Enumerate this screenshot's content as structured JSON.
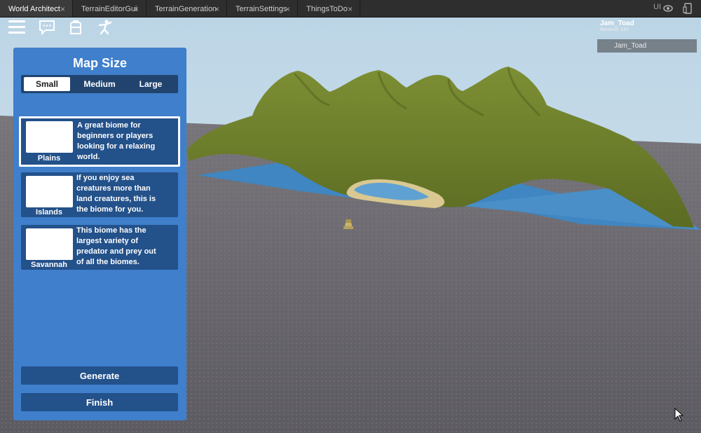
{
  "tabs": [
    {
      "label": "World Architect",
      "active": true
    },
    {
      "label": "TerrainEditorGui",
      "active": false
    },
    {
      "label": "TerrainGeneration",
      "active": false
    },
    {
      "label": "TerrainSettings",
      "active": false
    },
    {
      "label": "ThingsToDo",
      "active": false
    }
  ],
  "tab_close_glyph": "×",
  "toolbar_right": {
    "ui_label": "UI"
  },
  "player": {
    "name": "Jam_Toad",
    "account": "Account: 13+"
  },
  "player_list": {
    "entries": [
      "Jam_Toad"
    ]
  },
  "panel": {
    "title": "Map Size",
    "sizes": [
      {
        "label": "Small",
        "selected": true
      },
      {
        "label": "Medium",
        "selected": false
      },
      {
        "label": "Large",
        "selected": false
      }
    ],
    "biomes": [
      {
        "name": "Plains",
        "description_lines": [
          "A great biome for",
          "beginners or players",
          "looking for a relaxing",
          "world."
        ],
        "selected": true
      },
      {
        "name": "Islands",
        "description_lines": [
          "If you enjoy sea",
          "creatures more than",
          "land creatures, this is",
          "the biome for you."
        ],
        "selected": false
      },
      {
        "name": "Savannah",
        "description_lines": [
          "This biome has the",
          "largest variety of",
          "predator and prey out",
          "of all the biomes."
        ],
        "selected": false
      }
    ],
    "generate_label": "Generate",
    "finish_label": "Finish"
  },
  "colors": {
    "panel_bg": "#3f7fcc",
    "card_bg": "#23518a",
    "tab_bar": "#2e2e2e",
    "sky": "#c9dbe8",
    "baseplate": "#6e6b72",
    "grass": "#6c7f2c",
    "water": "#3f8ac4"
  },
  "icons": [
    "hamburger-menu-icon",
    "chat-icon",
    "backpack-icon",
    "emote-icon",
    "eye-icon",
    "device-icon",
    "mouse-cursor-icon"
  ]
}
